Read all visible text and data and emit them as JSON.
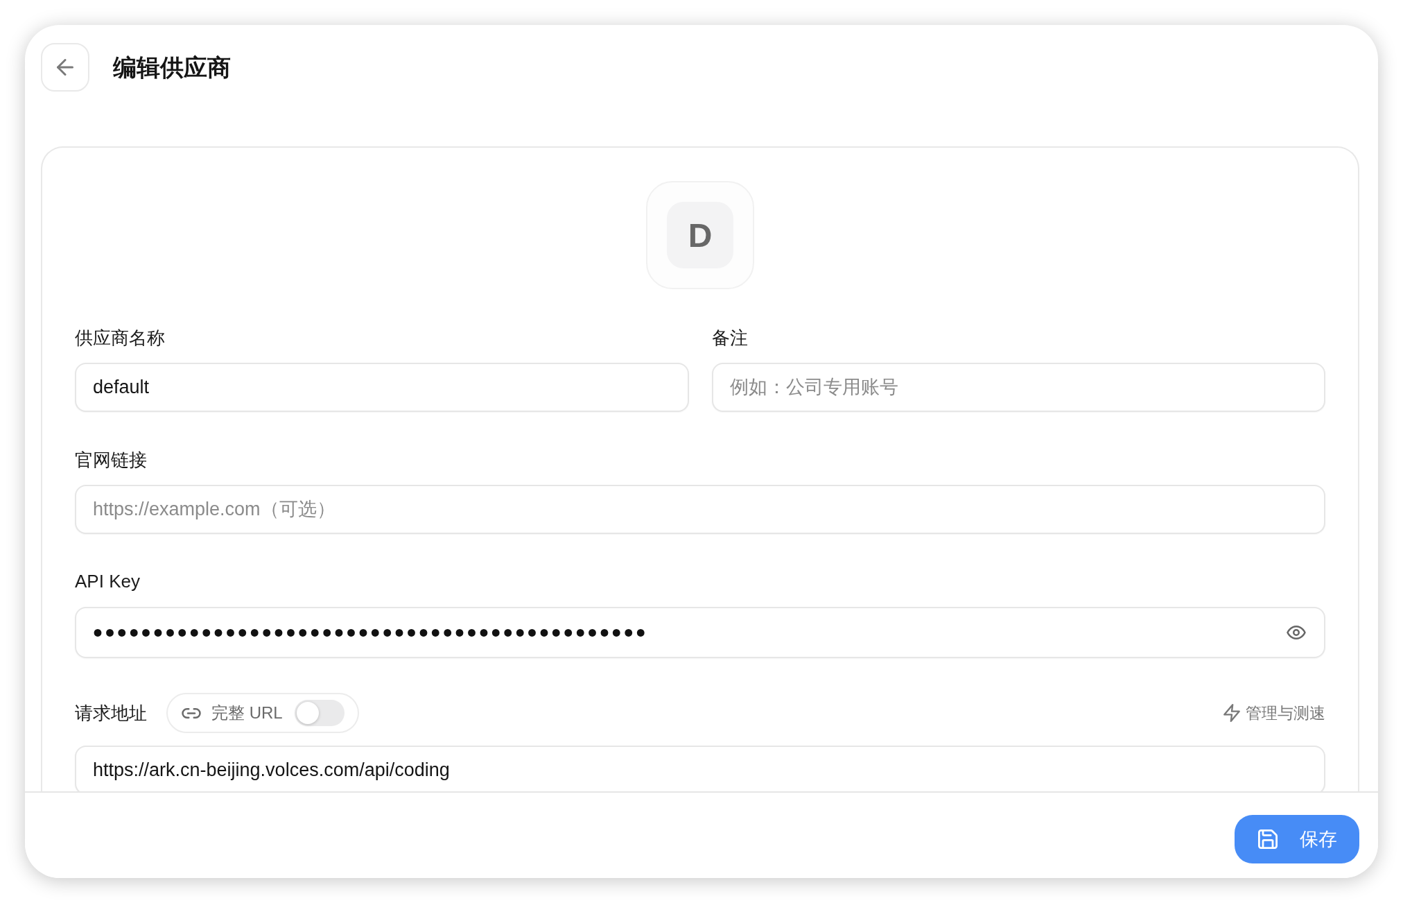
{
  "header": {
    "title": "编辑供应商"
  },
  "avatar": {
    "letter": "D"
  },
  "form": {
    "name": {
      "label": "供应商名称",
      "value": "default"
    },
    "note": {
      "label": "备注",
      "placeholder": "例如：公司专用账号"
    },
    "website": {
      "label": "官网链接",
      "placeholder": "https://example.com（可选）"
    },
    "api_key": {
      "label": "API Key",
      "value": "••••••••••••••••••••••••••••••••••••••••••••••"
    },
    "request_url": {
      "label": "请求地址",
      "full_url_toggle": {
        "label": "完整 URL",
        "on": false
      },
      "manage_link": "管理与测速",
      "value": "https://ark.cn-beijing.volces.com/api/coding"
    }
  },
  "footer": {
    "save_button": "保存"
  }
}
